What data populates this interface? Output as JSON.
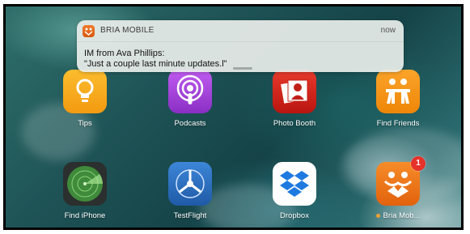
{
  "notification": {
    "app_name": "BRIA MOBILE",
    "time": "now",
    "title": "IM from Ava Phillips:",
    "message": "\"Just a couple last minute updates.l\"",
    "app_icon": "bria-logo-icon"
  },
  "home_screen": {
    "row1": [
      {
        "label": "Tips",
        "icon": "lightbulb-icon",
        "color": "#f6a81c"
      },
      {
        "label": "Podcasts",
        "icon": "podcast-icon",
        "color": "#9b3fd0"
      },
      {
        "label": "Photo Booth",
        "icon": "photo-booth-icon",
        "color": "#d8201e"
      },
      {
        "label": "Find Friends",
        "icon": "find-friends-icon",
        "color": "#f39a14"
      }
    ],
    "row2": [
      {
        "label": "Find iPhone",
        "icon": "radar-icon",
        "color": "#2a2a2a"
      },
      {
        "label": "TestFlight",
        "icon": "testflight-icon",
        "color": "#2c6bb5"
      },
      {
        "label": "Dropbox",
        "icon": "dropbox-icon",
        "color": "#ffffff"
      },
      {
        "label": "Bria Mob...",
        "icon": "bria-icon",
        "color": "#f07820",
        "badge": "1"
      }
    ]
  }
}
